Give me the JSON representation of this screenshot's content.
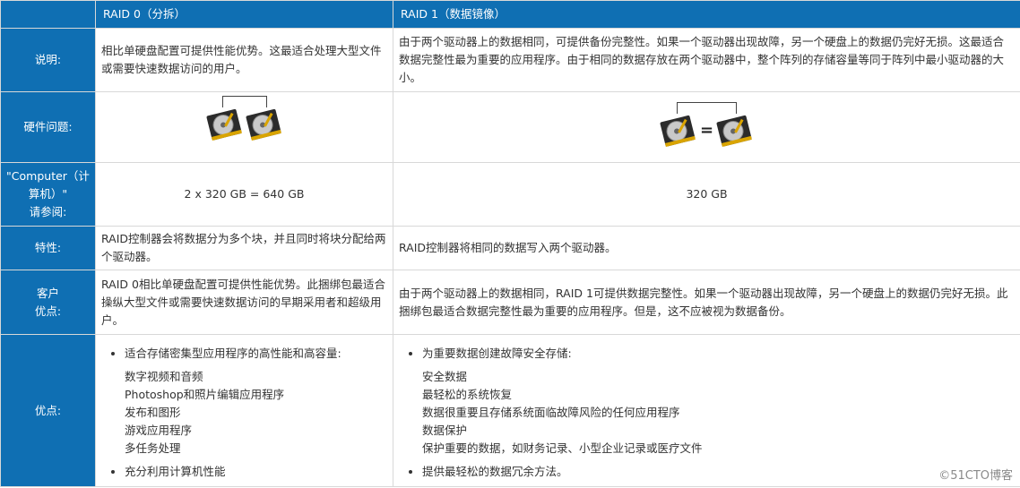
{
  "header": {
    "raid0": "RAID 0（分拆）",
    "raid1": "RAID 1（数据镜像）"
  },
  "rows": {
    "description": {
      "label": "说明:",
      "raid0": "相比单硬盘配置可提供性能优势。这最适合处理大型文件或需要快速数据访问的用户。",
      "raid1": "由于两个驱动器上的数据相同，可提供备份完整性。如果一个驱动器出现故障，另一个硬盘上的数据仍完好无损。这最适合数据完整性最为重要的应用程序。由于相同的数据存放在两个驱动器中，整个阵列的存储容量等同于阵列中最小驱动器的大小。"
    },
    "hardware": {
      "label": "硬件问题:",
      "raid0_icon": "two-hard-drives-striped-icon",
      "raid1_icon": "two-hard-drives-mirrored-icon",
      "raid1_equals": "="
    },
    "computer": {
      "label_line1": "\"Computer（计",
      "label_line2": "算机）\"",
      "label_line3": "请参阅:",
      "raid0": "2 x 320 GB = 640 GB",
      "raid1": "320 GB"
    },
    "features": {
      "label": "特性:",
      "raid0": "RAID控制器会将数据分为多个块，并且同时将块分配给两个驱动器。",
      "raid1": "RAID控制器将相同的数据写入两个驱动器。"
    },
    "customer": {
      "label_line1": "客户",
      "label_line2": "优点:",
      "raid0": "RAID 0相比单硬盘配置可提供性能优势。此捆绑包最适合操纵大型文件或需要快速数据访问的早期采用者和超级用户。",
      "raid1": "由于两个驱动器上的数据相同，RAID 1可提供数据完整性。如果一个驱动器出现故障，另一个硬盘上的数据仍完好无损。此捆绑包最适合数据完整性最为重要的应用程序。但是，这不应被视为数据备份。"
    },
    "advantages": {
      "label": "优点:",
      "raid0": {
        "lead": "适合存储密集型应用程序的高性能和高容量:",
        "items": [
          "数字视频和音频",
          "Photoshop和照片编辑应用程序",
          "发布和图形",
          "游戏应用程序",
          "多任务处理"
        ],
        "tail": "充分利用计算机性能"
      },
      "raid1": {
        "lead": "为重要数据创建故障安全存储:",
        "items": [
          "安全数据",
          "最轻松的系统恢复",
          "数据很重要且存储系统面临故障风险的任何应用程序",
          "数据保护",
          "保护重要的数据，如财务记录、小型企业记录或医疗文件"
        ],
        "tail": "提供最轻松的数据冗余方法。"
      }
    }
  },
  "watermark": "©51CTO博客"
}
